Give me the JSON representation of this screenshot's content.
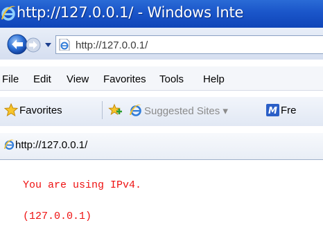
{
  "window": {
    "title": "http://127.0.0.1/ - Windows Inte"
  },
  "navigation": {
    "address": "http://127.0.0.1/"
  },
  "menu": {
    "items": [
      "File",
      "Edit",
      "View",
      "Favorites",
      "Tools",
      "Help"
    ]
  },
  "favorites_bar": {
    "favorites_label": "Favorites",
    "suggested_sites_label": "Suggested Sites ▾",
    "msn_label": "Fre"
  },
  "tab": {
    "title": "http://127.0.0.1/"
  },
  "content": {
    "line1": "You are using IPv4.",
    "line2": "(127.0.0.1)",
    "text_color": "#ee1111"
  },
  "icons": {
    "title_icon": "ie-icon",
    "back": "back-arrow-icon",
    "forward": "forward-arrow-icon",
    "address_page": "ie-page-icon",
    "favorites": "star-icon",
    "add_favorites": "add-favorites-icon",
    "suggested": "ie-icon",
    "msn": "msn-icon",
    "tab": "ie-icon"
  }
}
